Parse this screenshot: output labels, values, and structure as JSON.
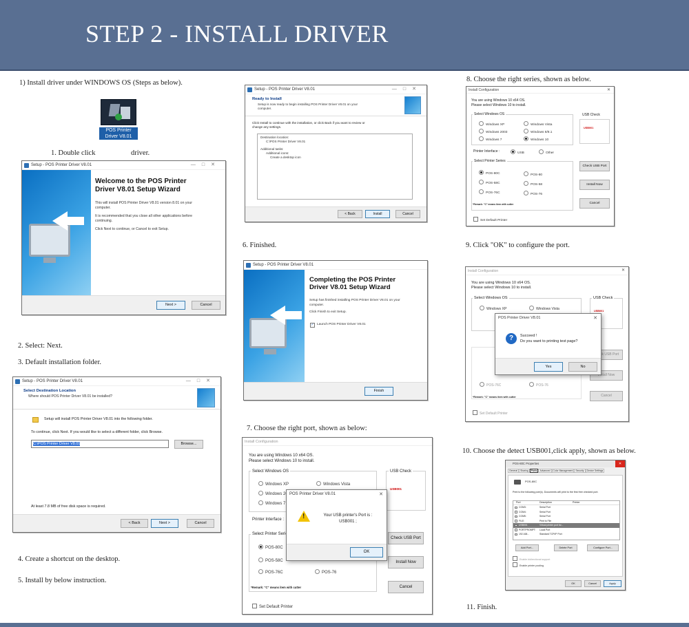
{
  "header": {
    "title": "STEP 2 - INSTALL DRIVER"
  },
  "steps": {
    "s1": "1) Install driver under WINDOWS OS (Steps as below).",
    "s1b_a": "1. Double click",
    "s1b_b": "driver.",
    "s2": "2. Select: Next.",
    "s3": "3. Default installation folder.",
    "s4": "4. Create a shortcut on the desktop.",
    "s5": "5. Install by below instruction.",
    "s6": "6. Finished.",
    "s7": "7. Choose the right port, shown as below:",
    "s8": "8. Choose the right series, shown as below.",
    "s9": "9. Click \"OK\" to configure the port.",
    "s10": "10. Choose the detect USB001,click apply, shown as below.",
    "s11": "11. Finish."
  },
  "icon": {
    "name": "installer-icon",
    "label_line1": "POS Printer",
    "label_line2": "Driver V8.01"
  },
  "setup": {
    "title": "Setup - POS Printer Driver V8.01",
    "welcome_h1": "Welcome to the POS Printer",
    "welcome_h2": "Driver V8.01 Setup Wizard",
    "welcome_p1a": "This will install POS Printer Driver V8.01 version 8.01 on your",
    "welcome_p1b": "computer.",
    "welcome_p2a": "It is recommended that you close all other applications before",
    "welcome_p2b": "continuing.",
    "welcome_p3": "Click Next to continue, or Cancel to exit Setup.",
    "next": "Next >",
    "cancel": "Cancel",
    "back": "< Back",
    "install": "Install",
    "finish": "Finish",
    "browse": "Browse...",
    "dest_h": "Select Destination Location",
    "dest_p": "Where should POS Printer Driver V8.01 be installed?",
    "dest_line1": "Setup will install POS Printer Driver V8.01 into the following folder.",
    "dest_line2": "To continue, click Next. If you would like to select a different folder, click Browse.",
    "dest_path": "C:\\POS Printer Driver V8.01",
    "dest_space": "At least 7.8 MB of free disk space is required.",
    "ready_h": "Ready to Install",
    "ready_p1": "Setup is now ready to begin installing POS Printer Driver V8.01 on your",
    "ready_p2": "computer.",
    "ready_l1": "Click Install to continue with the installation, or click Back if you want to review or",
    "ready_l2": "change any settings.",
    "ready_b1": "Destination location:",
    "ready_b2": "C:\\POS Printer Driver V8.01",
    "ready_b3": "Additional tasks:",
    "ready_b4": "Additional icons:",
    "ready_b5": "Create a desktop icon",
    "done_h1": "Completing the POS Printer",
    "done_h2": "Driver V8.01 Setup Wizard",
    "done_p1a": "Setup has finished installing POS Printer Driver V8.01 on your",
    "done_p1b": "computer.",
    "done_p2": "Click Finish to exit Setup.",
    "done_chk": "Launch POS Printer Driver V8.01"
  },
  "config": {
    "title": "Install Configuration",
    "using": "You are using Windows 10 x64 OS.",
    "please": "Please select Windows 10 to install.",
    "os_label": "Select Windows OS",
    "os": [
      "Windows XP",
      "Windows Vista",
      "Windows 2003",
      "Windows 8/8.1",
      "Windows 7",
      "Windows 10"
    ],
    "usb_check": "USB Check",
    "usb_value": "USB001",
    "iface_label": "Printer Interface :",
    "iface_usb": "USB",
    "iface_other": "Other",
    "series_label": "Select Printer Series",
    "series": [
      "POS-80C",
      "POS-80",
      "POS-58C",
      "POS-58",
      "POS-76C",
      "POS-76"
    ],
    "check_port": "Check USB Port",
    "install_now": "Install Now",
    "cancel": "Cancel",
    "remark": "*Remark: \"C\" means item with cutter",
    "set_default": "Set Default Printer"
  },
  "port_dialog": {
    "title": "POS Printer Driver V8.01",
    "line1": "Your USB printer's Port is :",
    "line2": "USB001 ;",
    "ok": "OK"
  },
  "success_dialog": {
    "title": "POS Printer Driver V8.01",
    "line1": "Succeed !",
    "line2": "Do you want to printing test page?",
    "yes": "Yes",
    "no": "No"
  },
  "props": {
    "title": "POS-80C Properties",
    "tabs": [
      "General",
      "Sharing",
      "Ports",
      "Advanced",
      "Color Management",
      "Security",
      "Device Settings"
    ],
    "printer": "POS-80C",
    "hint": "Print to the following port(s). Documents will print to the first free checked port.",
    "col_port": "Port",
    "col_desc": "Description",
    "col_printer": "Printer",
    "ports": [
      [
        "COM3:",
        "Serial Port"
      ],
      [
        "COM4:",
        "Serial Port"
      ],
      [
        "COM5:",
        "Serial Port"
      ],
      [
        "FILE:",
        "Print to File"
      ],
      [
        "USB001",
        "Virtual printer port for..."
      ],
      [
        "PORTPROMPT:",
        "Local Port"
      ],
      [
        "192.168...",
        "Standard TCP/IP Port"
      ]
    ],
    "add_port": "Add Port...",
    "delete_port": "Delete Port",
    "configure_port": "Configure Port...",
    "bidi": "Enable bidirectional support",
    "pool": "Enable printer pooling",
    "ok": "OK",
    "cancel": "Cancel",
    "apply": "Apply"
  }
}
